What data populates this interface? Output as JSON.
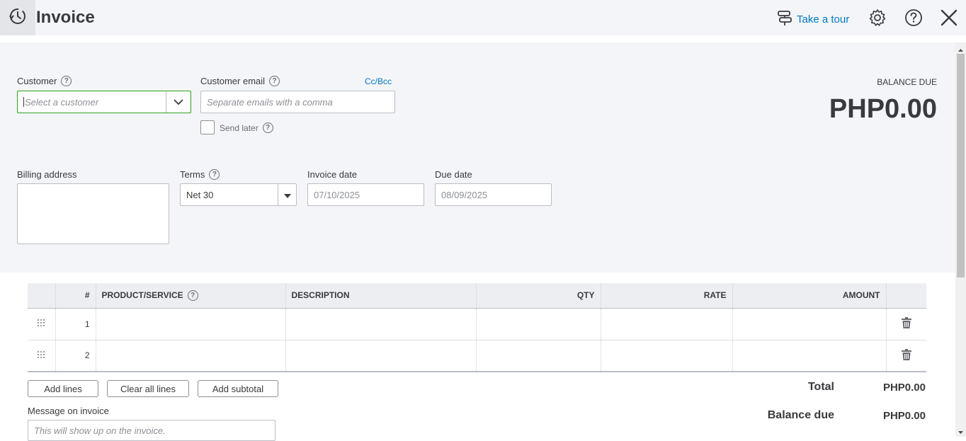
{
  "header": {
    "title": "Invoice",
    "tour_label": "Take a tour"
  },
  "customer": {
    "label": "Customer",
    "placeholder": "Select a customer"
  },
  "email": {
    "label": "Customer email",
    "placeholder": "Separate emails with a comma",
    "cc_bcc": "Cc/Bcc",
    "send_later": "Send later"
  },
  "balance": {
    "label": "BALANCE DUE",
    "value": "PHP0.00"
  },
  "billing": {
    "label": "Billing address"
  },
  "terms": {
    "label": "Terms",
    "value": "Net 30"
  },
  "invoice_date": {
    "label": "Invoice date",
    "value": "07/10/2025"
  },
  "due_date": {
    "label": "Due date",
    "value": "08/09/2025"
  },
  "table": {
    "headers": [
      "#",
      "PRODUCT/SERVICE",
      "DESCRIPTION",
      "QTY",
      "RATE",
      "AMOUNT"
    ],
    "rows": [
      {
        "num": "1"
      },
      {
        "num": "2"
      }
    ]
  },
  "buttons": {
    "add_lines": "Add lines",
    "clear_all": "Clear all lines",
    "add_subtotal": "Add subtotal"
  },
  "message": {
    "label": "Message on invoice",
    "placeholder": "This will show up on the invoice."
  },
  "totals": {
    "total_label": "Total",
    "total_value": "PHP0.00",
    "balance_due_label": "Balance due",
    "balance_due_value": "PHP0.00"
  }
}
